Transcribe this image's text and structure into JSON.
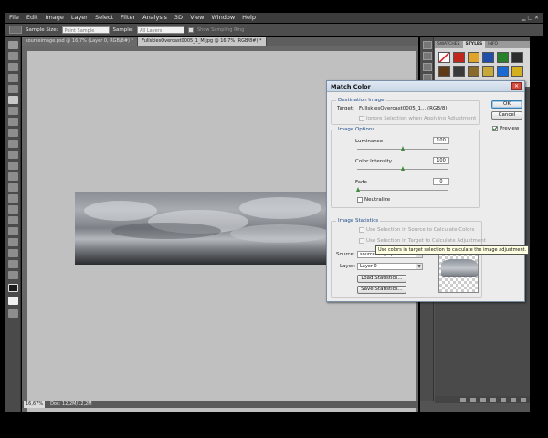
{
  "menubar": {
    "items": [
      "File",
      "Edit",
      "Image",
      "Layer",
      "Select",
      "Filter",
      "Analysis",
      "3D",
      "View",
      "Window",
      "Help"
    ]
  },
  "options": {
    "sample_size_label": "Sample Size:",
    "sample_size_value": "Point Sample",
    "sample_label": "Sample:",
    "sample_value": "All Layers",
    "show_ring": "Show Sampling Ring"
  },
  "documents": {
    "tabs": [
      "sourceimage.psd @ 16,7% (Layer 0, RGB/8#) *",
      "FullskiesOvercast0005_1_M.jpg @ 16,7% (RGB/8#) *"
    ]
  },
  "status": {
    "zoom": "16,67%",
    "doc_info": "Doc: 12,2M/12,2M"
  },
  "panels": {
    "tabs": [
      "SWATCHES",
      "STYLES",
      "INFO"
    ]
  },
  "dialog": {
    "title": "Match Color",
    "destination": {
      "group_title": "Destination Image",
      "target_label": "Target:",
      "target_value": "FullskiesOvercast0005_1... (RGB/8)",
      "ignore_selection": "Ignore Selection when Applying Adjustment"
    },
    "image_options": {
      "group_title": "Image Options",
      "luminance_label": "Luminance",
      "luminance_value": "100",
      "color_intensity_label": "Color Intensity",
      "color_intensity_value": "100",
      "fade_label": "Fade",
      "fade_value": "0",
      "neutralize_label": "Neutralize"
    },
    "image_statistics": {
      "group_title": "Image Statistics",
      "use_source_selection": "Use Selection in Source to Calculate Colors",
      "use_target_selection": "Use Selection in Target to Calculate Adjustment",
      "source_label": "Source:",
      "source_value": "sourceimage.psd",
      "layer_label": "Layer:",
      "layer_value": "Layer 0",
      "load_button": "Load Statistics...",
      "save_button": "Save Statistics..."
    },
    "ok_button": "OK",
    "cancel_button": "Cancel",
    "preview_label": "Preview",
    "tooltip": "Use colors in target selection to calculate the image adjustment."
  },
  "colors": {
    "ui_dark": "#3c3c3c",
    "canvas_gray": "#c0c0c0",
    "dialog_bg": "#ececec",
    "group_title_blue": "#1d4a8a",
    "slider_thumb_green": "#3a8a3a",
    "close_red": "#d64a3c"
  }
}
